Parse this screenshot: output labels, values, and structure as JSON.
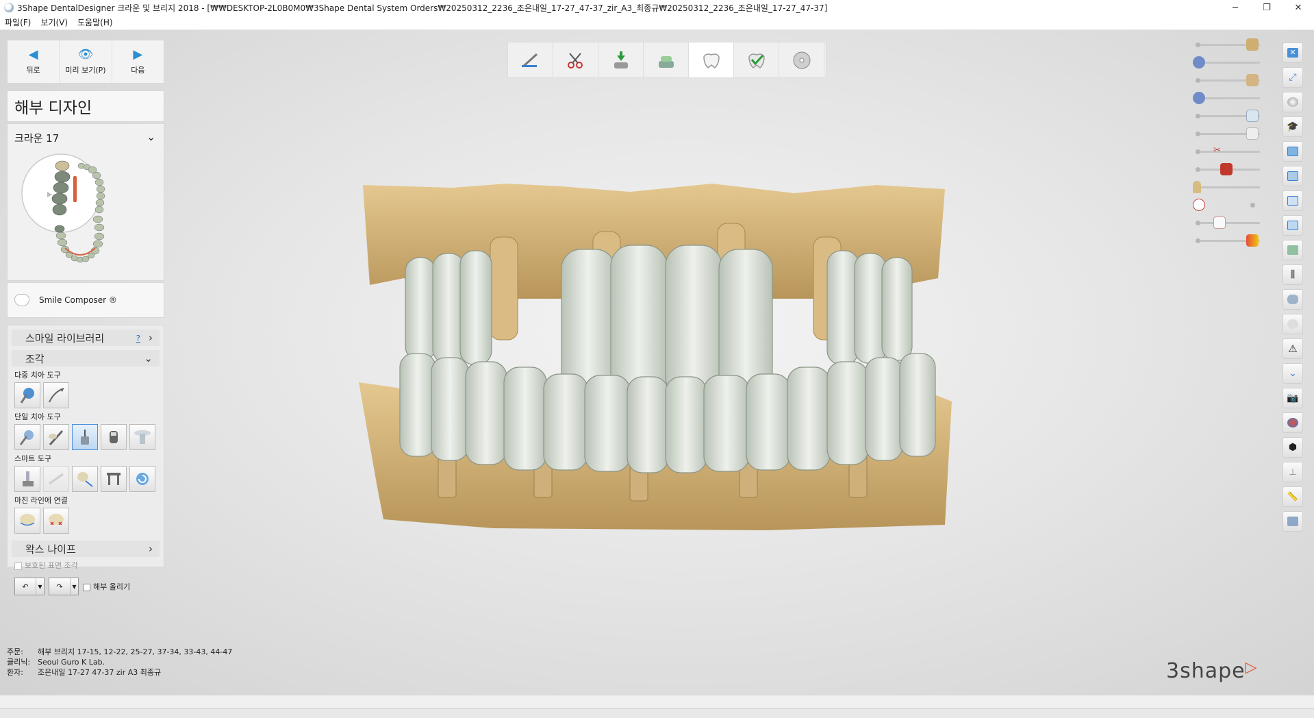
{
  "window": {
    "title": "3Shape DentalDesigner 크라운 및 브리지 2018 - [₩₩DESKTOP-2L0B0M0₩3Shape Dental System Orders₩20250312_2236_조은내일_17-27_47-37_zir_A3_최종규₩20250312_2236_조은내일_17-27_47-37]",
    "minimize": "─",
    "restore": "❐",
    "close": "✕"
  },
  "menu": [
    "파일(F)",
    "보기(V)",
    "도움말(H)"
  ],
  "nav": {
    "back": "뒤로",
    "preview": "미리 보기(P)",
    "next": "다음"
  },
  "panel": {
    "title": "해부 디자인",
    "crown_selector": "크라운 17",
    "smile_composer": "Smile Composer ®",
    "smile_library": "스마일 라이브러리",
    "help": "?",
    "sculpt": "조각",
    "multi_tooth_tools": "다중 치아 도구",
    "single_tooth_tools": "단일 치아 도구",
    "smart_tools": "스마트 도구",
    "margin_connect": "마진 라인에 연결",
    "wax_knife": "왁스 나이프",
    "protected_surface": "보호된 표면 조각",
    "raise_anatomy": "해부 올리기"
  },
  "order": {
    "order_key": "주문:",
    "order_value": "해부 브리지 17-15, 12-22, 25-27, 37-34, 33-43, 44-47",
    "clinic_key": "클리닉:",
    "clinic_value": "Seoul Guro K Lab.",
    "patient_key": "환자:",
    "patient_value": "조은내일 17-27 47-37 zir A3 최종규"
  },
  "logo": "3shape",
  "icons": {
    "workflow": [
      "scan-brush-icon",
      "trim-scissors-icon",
      "insertion-icon",
      "die-icon",
      "crown-tooth-icon",
      "check-tooth-icon",
      "disc-icon"
    ],
    "right_strip": [
      "close-view-icon",
      "fit-view-icon",
      "sphere-icon",
      "graduation-cap-icon",
      "view-front-icon",
      "view-side-icon",
      "view-top-icon",
      "view-cross-icon",
      "lamp-icon",
      "table-icon",
      "cylinder-icon",
      "ghost-tooth-icon",
      "warning-icon",
      "fold-icon",
      "camera-icon",
      "palette-icon",
      "cube-icon",
      "pin-icon",
      "measure-icon",
      "lab-icon"
    ]
  },
  "colors": {
    "accent": "#2a8ed3",
    "gold": "#d9bb83",
    "crown": "#d8e0d6",
    "brand_red": "#e2532d"
  }
}
